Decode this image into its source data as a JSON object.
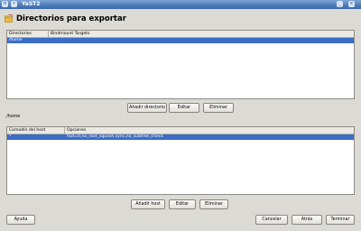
{
  "window": {
    "title": "YaST2"
  },
  "heading": "Directorios para exportar",
  "directories_table": {
    "columns": [
      "Directories",
      "Bindmount Targets"
    ],
    "rows": [
      {
        "directory": "/home",
        "bindmount": ""
      }
    ]
  },
  "directory_buttons": {
    "add": "Añadir directorio",
    "edit": "Editar",
    "delete": "Eliminar"
  },
  "selected_directory_label": "/home",
  "hosts_table": {
    "columns": [
      "Comodín del host",
      "Opciones"
    ],
    "rows": [
      {
        "host": "*",
        "options": "fsid=0,no_root_squash,sync,no_subtree_check"
      }
    ]
  },
  "host_buttons": {
    "add": "Añadir host",
    "edit": "Editar",
    "delete": "Eliminar"
  },
  "footer": {
    "help": "Ayuda",
    "cancel": "Cancelar",
    "back": "Atrás",
    "finish": "Terminar"
  },
  "colors": {
    "selection": "#3b6cc6",
    "titlebar": "#4c7ab8",
    "background": "#dcdad5"
  }
}
